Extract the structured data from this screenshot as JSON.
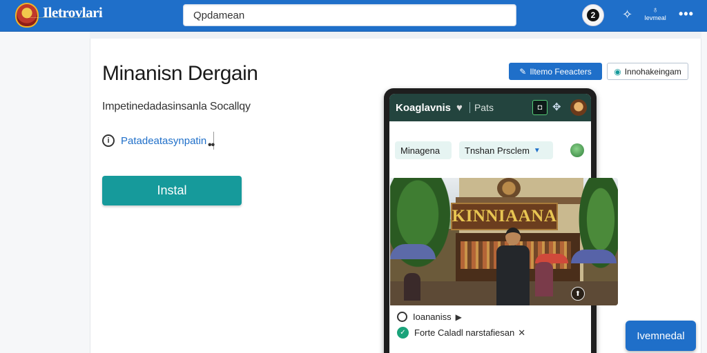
{
  "header": {
    "brand": "Iletrovlari",
    "search_placeholder": "Qpdamean",
    "avatar_initial": "2",
    "mini_label": "Ievmeal"
  },
  "app": {
    "title": "Minanisn Dergain",
    "subtitle": "Impetinedadasinsanla Socallqy",
    "info_link": "Patadeatasynpatin",
    "install_label": "Instal",
    "btn_primary_label": "Iltemo Feeacters",
    "btn_outline_label": "Innohakeingam"
  },
  "phone": {
    "title": "Koaglavnis",
    "tab": "Pats",
    "chip1": "Minagena",
    "chip2": "Tnshan Prsclem",
    "photo_sign": "KINNIAANA",
    "row1_label": "Ioananiss",
    "row2_label": "Forte Caladl narstafiesan"
  },
  "fab_label": "Ivemnedal",
  "colors": {
    "topbar": "#1f6fc9",
    "accent_teal": "#169a9b",
    "phone_header": "#23443e"
  }
}
